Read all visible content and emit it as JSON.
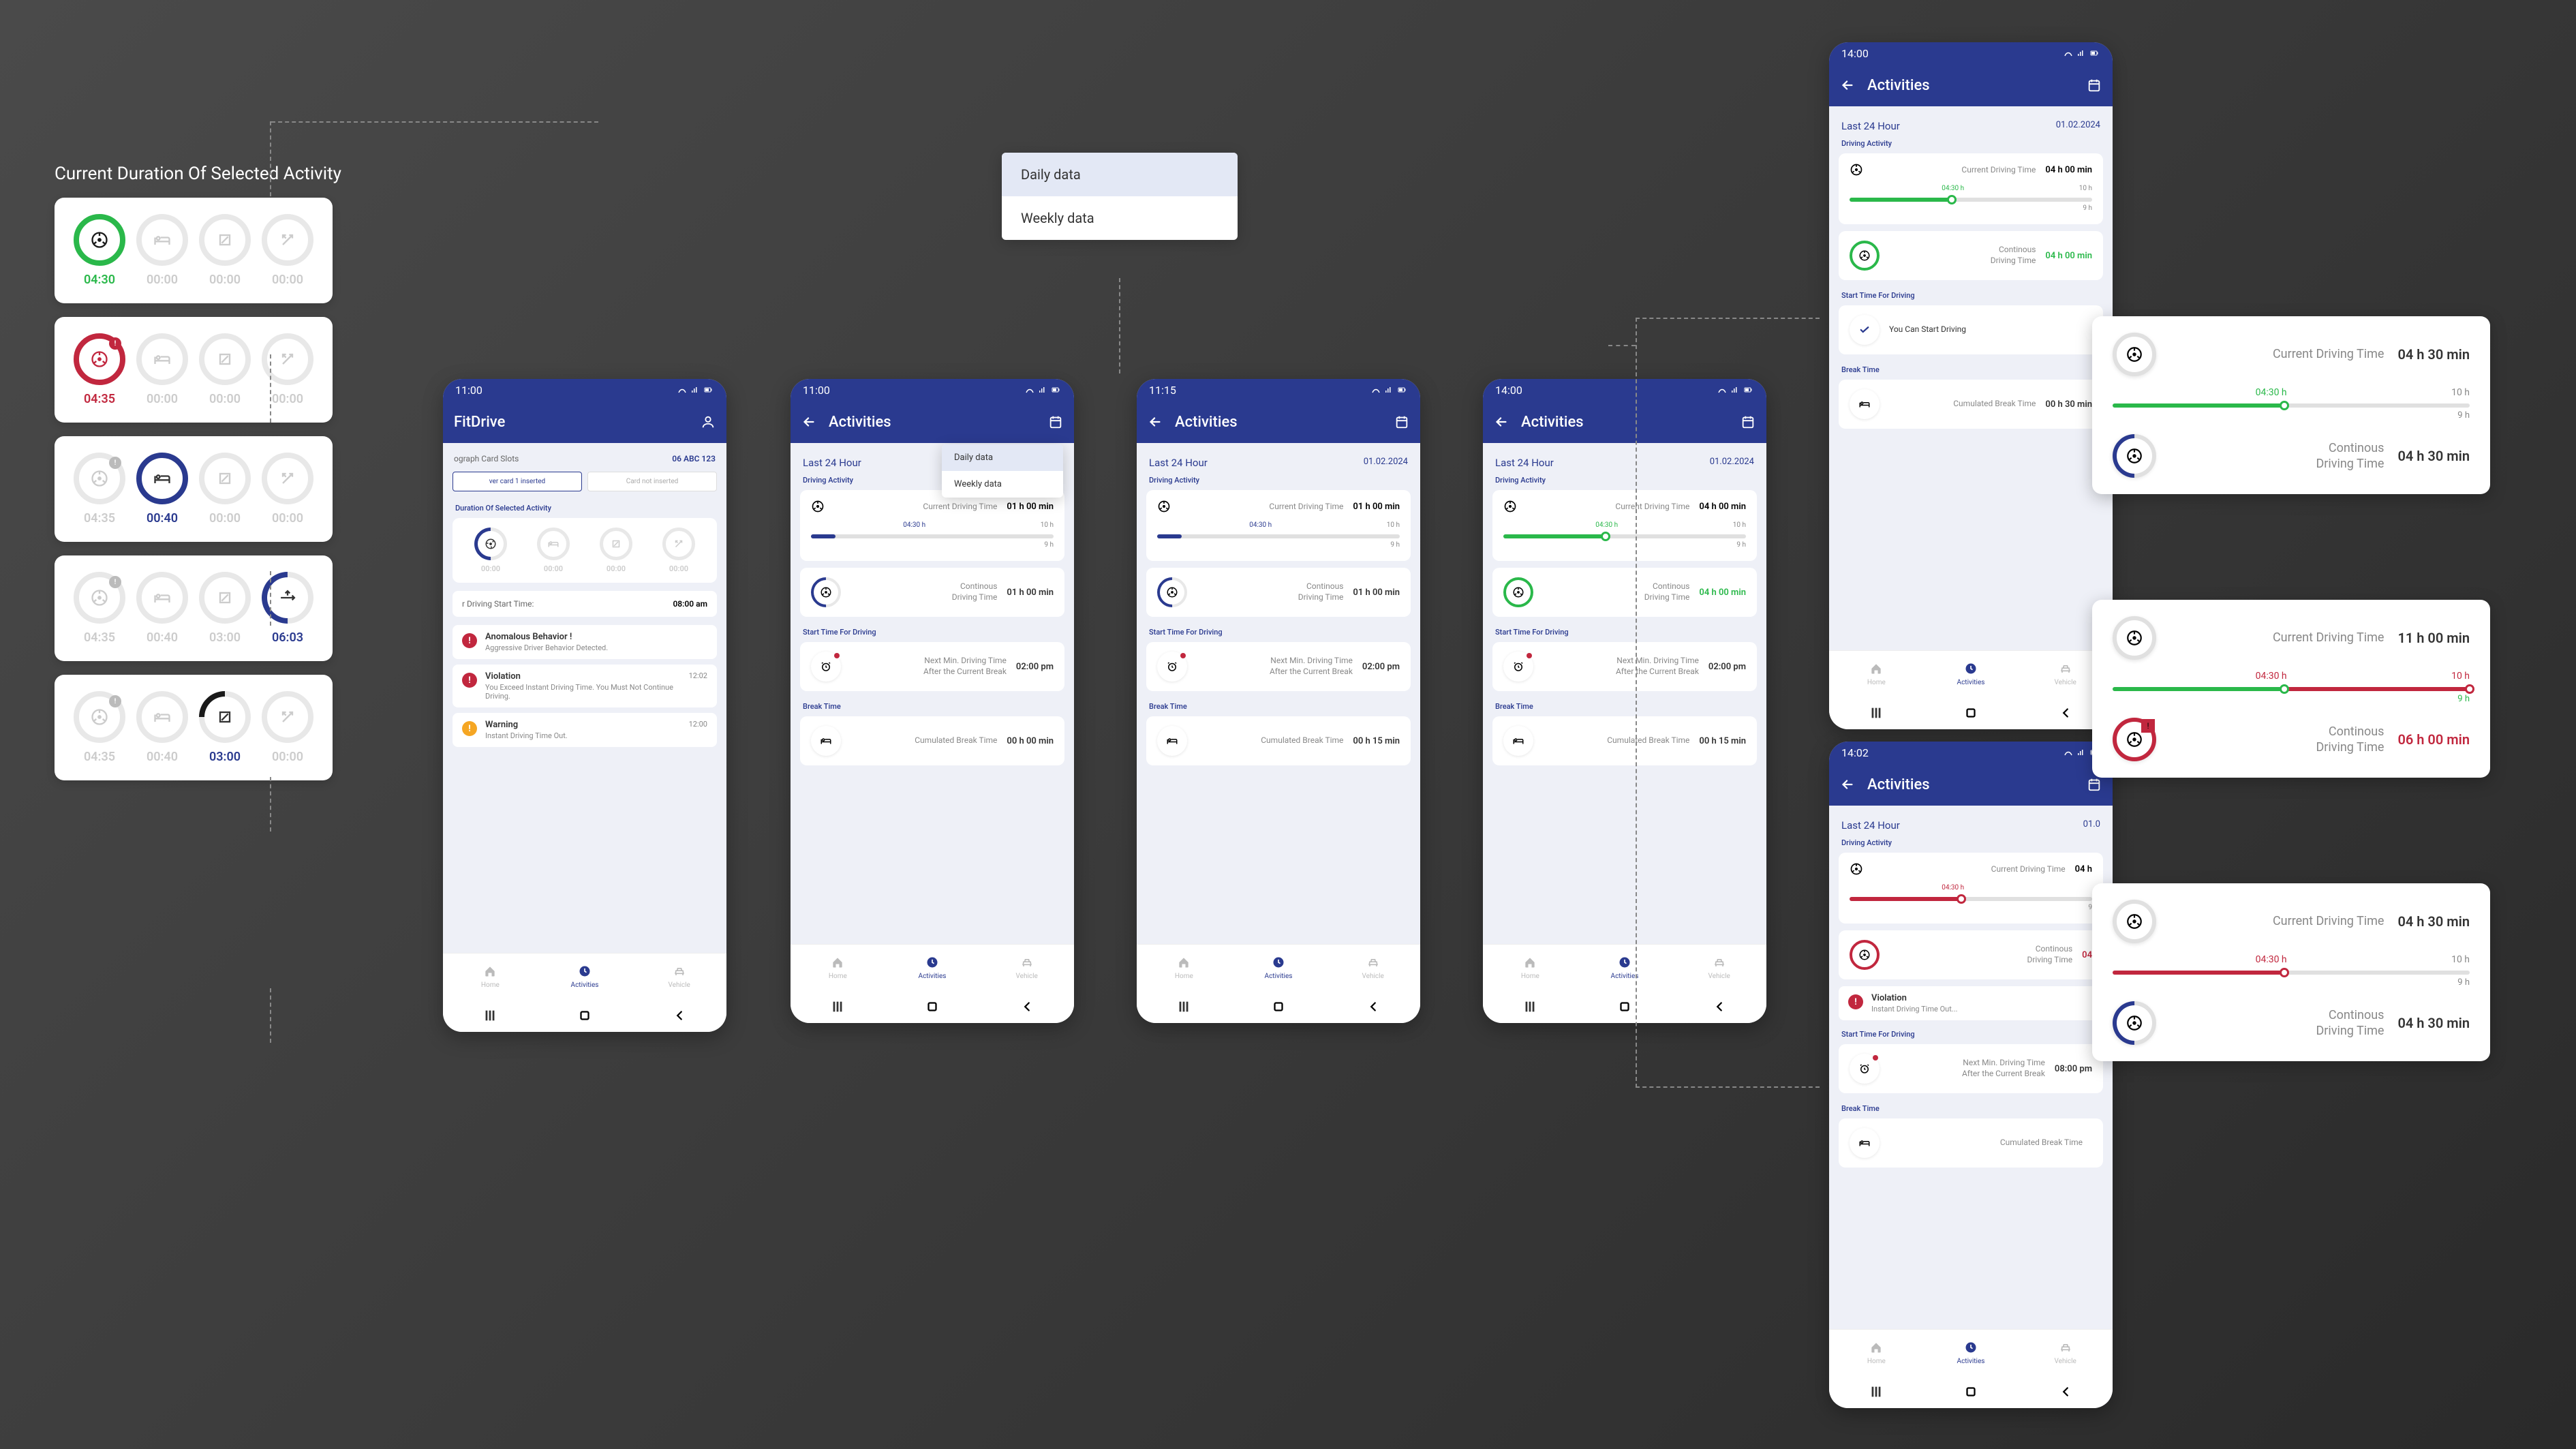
{
  "title": "Current Duration Of Selected Activity",
  "activity_cards": [
    {
      "items": [
        {
          "icon": "wheel",
          "ring": "green",
          "time": "04:30",
          "tclass": "green"
        },
        {
          "icon": "bed",
          "ring": "faded",
          "time": "00:00",
          "tclass": ""
        },
        {
          "icon": "square",
          "ring": "faded",
          "time": "00:00",
          "tclass": ""
        },
        {
          "icon": "tools",
          "ring": "faded",
          "time": "00:00",
          "tclass": ""
        }
      ]
    },
    {
      "items": [
        {
          "icon": "wheel",
          "ring": "red",
          "time": "04:35",
          "tclass": "red",
          "badge": "!"
        },
        {
          "icon": "bed",
          "ring": "faded",
          "time": "00:00",
          "tclass": ""
        },
        {
          "icon": "square",
          "ring": "faded",
          "time": "00:00",
          "tclass": ""
        },
        {
          "icon": "tools",
          "ring": "faded",
          "time": "00:00",
          "tclass": ""
        }
      ]
    },
    {
      "items": [
        {
          "icon": "wheel",
          "ring": "faded",
          "time": "04:35",
          "tclass": "",
          "badge": "!"
        },
        {
          "icon": "bed",
          "ring": "blue-full",
          "time": "00:40",
          "tclass": "blue"
        },
        {
          "icon": "square",
          "ring": "faded",
          "time": "00:00",
          "tclass": ""
        },
        {
          "icon": "tools",
          "ring": "faded",
          "time": "00:00",
          "tclass": ""
        }
      ]
    },
    {
      "items": [
        {
          "icon": "wheel",
          "ring": "faded",
          "time": "04:35",
          "tclass": "",
          "badge": "!"
        },
        {
          "icon": "bed",
          "ring": "faded",
          "time": "00:40",
          "tclass": ""
        },
        {
          "icon": "square",
          "ring": "faded",
          "time": "03:00",
          "tclass": ""
        },
        {
          "icon": "tools",
          "ring": "blue",
          "time": "06:03",
          "tclass": "blue"
        }
      ]
    },
    {
      "items": [
        {
          "icon": "wheel",
          "ring": "faded",
          "time": "04:35",
          "tclass": "",
          "badge": "!"
        },
        {
          "icon": "bed",
          "ring": "faded",
          "time": "00:40",
          "tclass": ""
        },
        {
          "icon": "square",
          "ring": "black",
          "time": "03:00",
          "tclass": "blue"
        },
        {
          "icon": "tools",
          "ring": "faded",
          "time": "00:00",
          "tclass": ""
        }
      ]
    }
  ],
  "popup": {
    "items": [
      "Daily data",
      "Weekly data"
    ],
    "selected": 0
  },
  "phones": {
    "home": {
      "time": "11:00",
      "title": "FitDrive",
      "tacho_label": "ograph Card Slots",
      "plate": "06 ABC 123",
      "slot1": "ver card 1 inserted",
      "slot2": "Card not inserted",
      "dur_label": "Duration Of Selected Activity",
      "dur_items": [
        {
          "icon": "wheel",
          "ring": "blue",
          "time": "00:00"
        },
        {
          "icon": "bed",
          "ring": "faded",
          "time": "00:00"
        },
        {
          "icon": "square",
          "ring": "faded",
          "time": "00:00"
        },
        {
          "icon": "tools",
          "ring": "faded",
          "time": "00:00"
        }
      ],
      "start_label": "r Driving Start Time:",
      "start_value": "08:00 am",
      "alerts": [
        {
          "type": "red",
          "title": "Anomalous Behavior !",
          "text": "Aggressive Driver Behavior Detected.",
          "time": ""
        },
        {
          "type": "red",
          "title": "Violation",
          "text": "You Exceed Instant Driving Time. You Must Not Continue Driving.",
          "time": "12:02"
        },
        {
          "type": "orange",
          "title": "Warning",
          "text": "Instant Driving Time Out.",
          "time": "12:00"
        }
      ],
      "nav": [
        "Home",
        "Activities",
        "Vehicle"
      ]
    },
    "act1": {
      "time": "11:00",
      "title": "Activities",
      "header": "Last 24 Hour",
      "date": "",
      "driving_label": "Driving Activity",
      "cdt_label": "Current Driving Time",
      "cdt_value": "01 h 00 min",
      "mark": "04:30 h",
      "max": "10 h",
      "target": "9 h",
      "fill": "10%",
      "fillc": "blue",
      "cont_label": "Continous\nDriving Time",
      "cont_value": "01 h 00 min",
      "cont_ring": "blue",
      "start_label": "Start Time For Driving",
      "next_label": "Next Min. Driving Time\nAfter the Current Break",
      "next_value": "02:00 pm",
      "break_label": "Break Time",
      "cum_label": "Cumulated Break Time",
      "cum_value": "00 h 00 min",
      "popup": true
    },
    "act2": {
      "time": "11:15",
      "title": "Activities",
      "header": "Last 24 Hour",
      "date": "01.02.2024",
      "cdt_value": "01 h 00 min",
      "mark": "04:30 h",
      "max": "10 h",
      "target": "9 h",
      "fill": "10%",
      "fillc": "blue",
      "cont_value": "01 h 00 min",
      "cont_ring": "blue",
      "next_value": "02:00 pm",
      "cum_value": "00 h 15 min"
    },
    "act3": {
      "time": "14:00",
      "title": "Activities",
      "header": "Last 24 Hour",
      "date": "01.02.2024",
      "cdt_value": "04 h 00 min",
      "mark": "04:30 h",
      "max": "10 h",
      "target": "9 h",
      "fill": "42%",
      "fillc": "green",
      "cont_value": "04 h 00 min",
      "cont_ring": "green",
      "cont_vclass": "green",
      "next_value": "02:00 pm",
      "cum_value": "00 h 15 min"
    },
    "act4": {
      "time": "14:00",
      "title": "Activities",
      "header": "Last 24 Hour",
      "date": "01.02.2024",
      "cdt_value": "04 h 00 min",
      "mark": "04:30 h",
      "max": "10 h",
      "target": "9 h",
      "fill": "42%",
      "fillc": "green",
      "cont_value": "04 h 00 min",
      "cont_ring": "green",
      "cont_vclass": "green",
      "start2_label": "Start Time For Driving",
      "can_start": "You Can Start Driving",
      "break_label": "Break Time",
      "cum_value": "00 h 30 min",
      "nav": [
        "Home",
        "Activities",
        "Vehicle"
      ]
    },
    "act5": {
      "time": "14:02",
      "title": "Activities",
      "header": "Last 24 Hour",
      "date": "01.0",
      "cdt_value": "04 h",
      "mark": "04:30 h",
      "max": "",
      "target": "9",
      "fill": "46%",
      "fillc": "red",
      "cont_value": "04",
      "cont_ring": "red",
      "cont_vclass": "red",
      "violation_title": "Violation",
      "violation_text": "Instant  Driving Time Out...",
      "start2_label": "Start Time For Driving",
      "next_label": "Next Min. Driving Time\nAfter the Current Break",
      "next_value": "08:00 pm",
      "break_label": "Break Time",
      "cum_label": "Cumulated Break Time",
      "nav": [
        "Home",
        "Activities",
        "Vehicle"
      ]
    }
  },
  "detail_cards": [
    {
      "cdt_label": "Current Driving Time",
      "cdt_value": "04 h 30 min",
      "mark": "04:30 h",
      "max": "10 h",
      "target": "9 h",
      "fill": "48%",
      "fillc": "green",
      "cont_label": "Continous\nDriving Time",
      "cont_value": "04 h 30 min",
      "cont_ring": "blue"
    },
    {
      "cdt_label": "Current Driving Time",
      "cdt_value": "11 h 00 min",
      "mark": "04:30 h",
      "max": "10 h",
      "maxc": "red",
      "target": "9 h",
      "fillg": "48%",
      "fillr": "100%",
      "cont_label": "Continous\nDriving Time",
      "cont_value": "06 h 00 min",
      "cont_vclass": "red",
      "cont_ring": "red",
      "badge": "!"
    },
    {
      "cdt_label": "Current Driving Time",
      "cdt_value": "04 h 30 min",
      "mark": "04:30 h",
      "max": "10 h",
      "target": "9 h",
      "fill": "48%",
      "fillc": "red",
      "thumbc": "red",
      "cont_label": "Continous\nDriving Time",
      "cont_value": "04 h 30 min",
      "cont_ring": "blue"
    }
  ],
  "labels": {
    "driving_activity": "Driving Activity",
    "cdt": "Current Driving Time",
    "cont": "Continous\nDriving Time",
    "start_for": "Start Time For Driving",
    "next_min": "Next Min. Driving Time\nAfter the Current Break",
    "break": "Break Time",
    "cum": "Cumulated Break Time"
  }
}
